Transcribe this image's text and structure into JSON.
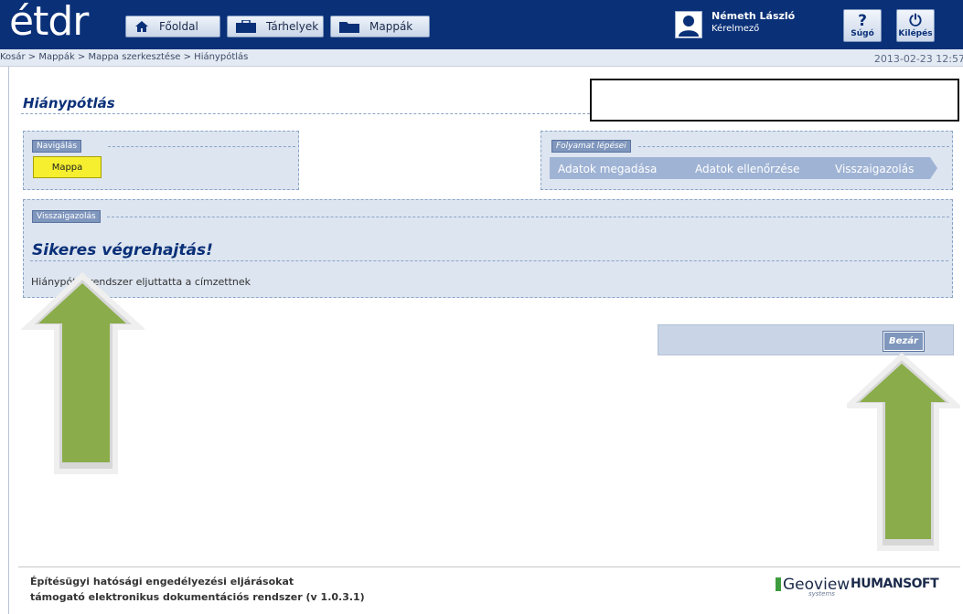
{
  "header": {
    "logo_text": "étdr",
    "nav": [
      {
        "label": "Főoldal",
        "icon": "home-icon"
      },
      {
        "label": "Tárhelyek",
        "icon": "briefcase-icon"
      },
      {
        "label": "Mappák",
        "icon": "folder-icon"
      }
    ],
    "user": {
      "name": "Németh László",
      "role": "Kérelmező"
    },
    "help_label": "Súgó",
    "logout_label": "Kilépés"
  },
  "breadcrumb": "Kosár > Mappák > Mappa szerkesztése > Hiánypótlás",
  "datetime": "2013-02-23 12:57",
  "page_title": "Hiánypótlás",
  "navigation": {
    "legend": "Navigálás",
    "button_label": "Mappa"
  },
  "process": {
    "legend": "Folyamat lépései",
    "steps": [
      "Adatok megadása",
      "Adatok ellenőrzése",
      "Visszaigazolás"
    ]
  },
  "confirmation": {
    "legend": "Visszaigazolás",
    "title": "Sikeres végrehajtás!",
    "message": "Hiánypót     a rendszer eljuttatta a címzettnek"
  },
  "close_label": "Bezár",
  "footer": {
    "line1": "Építésügyi hatósági engedélyezési eljárásokat",
    "line2": "támogató elektronikus dokumentációs rendszer (v 1.0.3.1)",
    "logo_geoview": "Geoview",
    "logo_geoview_sub": "systems",
    "logo_humansoft": "HUMANSOFT"
  },
  "colors": {
    "header_bg": "#0a3078",
    "panel_bg": "#dde5f0",
    "highlight_yellow": "#f5ef2f",
    "arrow_green": "#8aac4a"
  }
}
